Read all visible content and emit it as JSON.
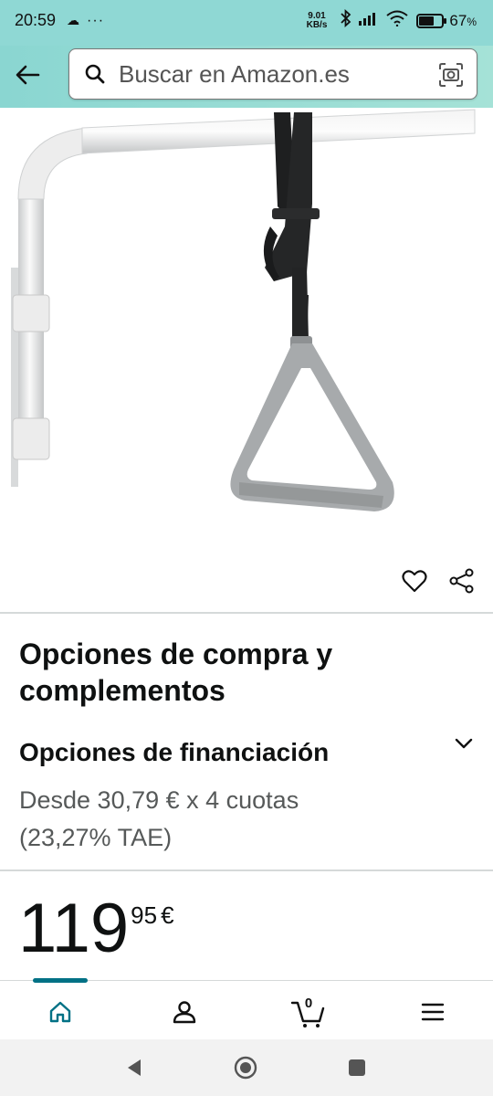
{
  "status_bar": {
    "time": "20:59",
    "net_speed_value": "9.01",
    "net_speed_unit": "KB/s",
    "battery_percent": "67",
    "battery_unit": "%",
    "battery_level": 0.67
  },
  "header": {
    "search_placeholder": "Buscar en Amazon.es"
  },
  "purchase": {
    "title": "Opciones de compra y complementos"
  },
  "financing": {
    "title": "Opciones de financiación",
    "details": "Desde 30,79 € x 4 cuotas (23,27% TAE)"
  },
  "price": {
    "whole": "119",
    "fraction": "95",
    "currency": "€"
  },
  "bottom_nav": {
    "cart_count": "0",
    "items": [
      "home-icon",
      "account-icon",
      "cart-icon",
      "menu-icon"
    ]
  },
  "colors": {
    "header_bg": "#8ad6d1",
    "accent": "#007185",
    "text_primary": "#0f1111",
    "text_secondary": "#565959"
  }
}
